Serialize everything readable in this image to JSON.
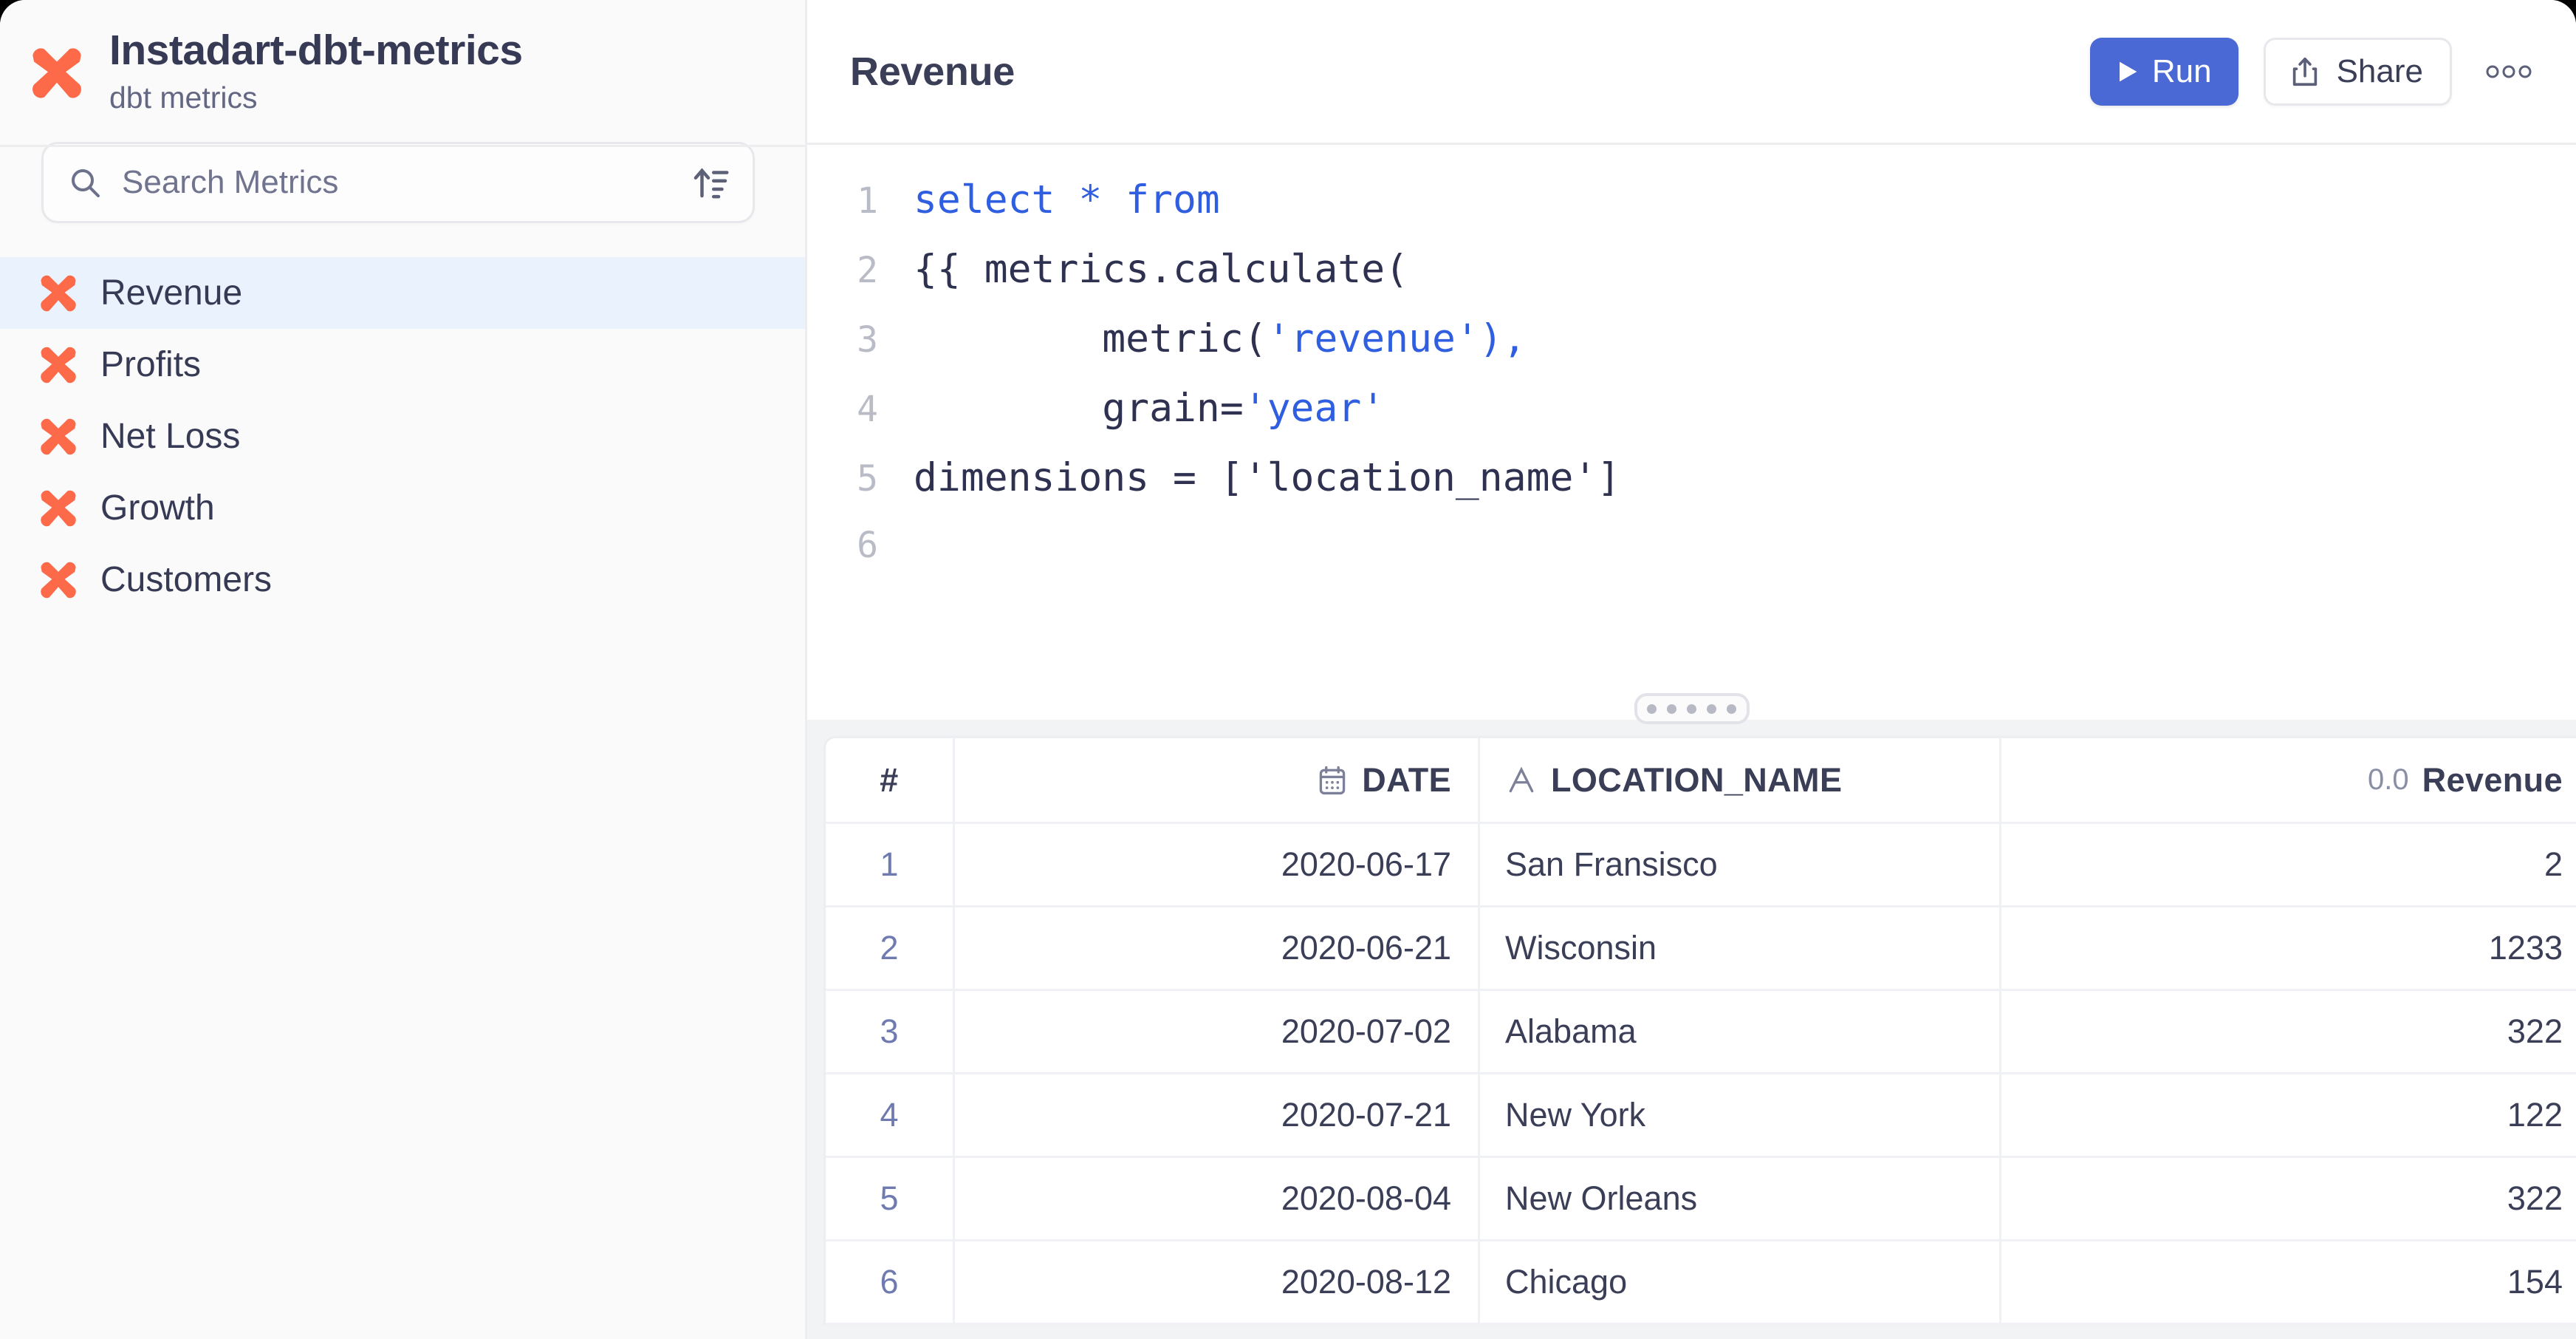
{
  "colors": {
    "brand_orange": "#fc6a49",
    "accent_blue": "#4a69d4",
    "selected_row_bg": "#eaf2fd",
    "text_dark": "#373a54",
    "text_muted": "#70748f",
    "code_keyword": "#2f5fe0",
    "code_string": "#2f5fe0",
    "row_number": "#6f7bb0"
  },
  "sidebar": {
    "brand": {
      "logo_icon": "dbt-logo-icon",
      "title": "Instadart-dbt-metrics",
      "subtitle": "dbt metrics"
    },
    "search": {
      "icon": "search-icon",
      "placeholder": "Search Metrics",
      "value": "",
      "sort_icon": "sort-ascending-icon"
    },
    "items": [
      {
        "label": "Revenue",
        "icon": "dbt-logo-icon",
        "active": true
      },
      {
        "label": "Profits",
        "icon": "dbt-logo-icon",
        "active": false
      },
      {
        "label": "Net Loss",
        "icon": "dbt-logo-icon",
        "active": false
      },
      {
        "label": "Growth",
        "icon": "dbt-logo-icon",
        "active": false
      },
      {
        "label": "Customers",
        "icon": "dbt-logo-icon",
        "active": false
      }
    ]
  },
  "header": {
    "title": "Revenue",
    "run_label": "Run",
    "run_icon": "play-icon",
    "share_label": "Share",
    "share_icon": "share-upload-icon",
    "more_icon": "more-horizontal-icon"
  },
  "editor": {
    "lines": [
      {
        "number": "1",
        "segments": [
          {
            "text": "select * from",
            "type": "keyword"
          }
        ]
      },
      {
        "number": "2",
        "segments": [
          {
            "text": "{{ metrics.calculate(",
            "type": "plain"
          }
        ]
      },
      {
        "number": "3",
        "segments": [
          {
            "text": "        metric(",
            "type": "plain"
          },
          {
            "text": "'revenue'",
            "type": "string"
          },
          {
            "text": "),",
            "type": "plain"
          }
        ]
      },
      {
        "number": "4",
        "segments": [
          {
            "text": "        grain=",
            "type": "plain"
          },
          {
            "text": "'year'",
            "type": "string"
          }
        ]
      },
      {
        "number": "5",
        "segments": [
          {
            "text": "dimensions = ['location_name']",
            "type": "plain"
          }
        ]
      },
      {
        "number": "6",
        "segments": []
      }
    ]
  },
  "splitter": {
    "dots": 5,
    "name": "resize-handle"
  },
  "results": {
    "columns": [
      {
        "key": "num",
        "label": "#",
        "icon": "hash-icon",
        "align": "center"
      },
      {
        "key": "date",
        "label": "DATE",
        "icon": "calendar-icon",
        "align": "right"
      },
      {
        "key": "loc",
        "label": "LOCATION_NAME",
        "icon": "text-type-icon",
        "align": "left"
      },
      {
        "key": "rev",
        "label": "Revenue",
        "icon": "number-type-icon",
        "type_label": "0.0",
        "align": "right"
      }
    ],
    "rows": [
      {
        "num": "1",
        "date": "2020-06-17",
        "loc": "San Fransisco",
        "rev": "2"
      },
      {
        "num": "2",
        "date": "2020-06-21",
        "loc": "Wisconsin",
        "rev": "1233"
      },
      {
        "num": "3",
        "date": "2020-07-02",
        "loc": "Alabama",
        "rev": "322"
      },
      {
        "num": "4",
        "date": "2020-07-21",
        "loc": "New York",
        "rev": "122"
      },
      {
        "num": "5",
        "date": "2020-08-04",
        "loc": "New Orleans",
        "rev": "322"
      },
      {
        "num": "6",
        "date": "2020-08-12",
        "loc": "Chicago",
        "rev": "154"
      }
    ]
  }
}
